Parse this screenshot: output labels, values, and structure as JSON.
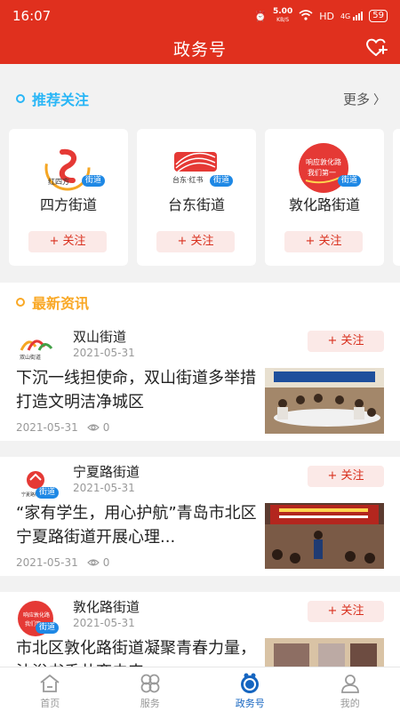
{
  "status": {
    "time": "16:07",
    "speed": "5.00",
    "speed_unit": "KB/S",
    "network": "HD",
    "signal": "4G",
    "battery": "59"
  },
  "header": {
    "title": "政务号"
  },
  "recommend": {
    "title": "推荐关注",
    "more": "更多",
    "items": [
      {
        "name": "四方街道",
        "tag": "街道",
        "follow": "+ 关注"
      },
      {
        "name": "台东街道",
        "tag": "街道",
        "follow": "+ 关注"
      },
      {
        "name": "敦化路街道",
        "tag": "街道",
        "follow": "+ 关注"
      }
    ]
  },
  "news": {
    "title": "最新资讯",
    "items": [
      {
        "source": "双山街道",
        "date": "2021-05-31",
        "follow": "+ 关注",
        "title": "下沉一线担使命，双山街道多举措打造文明洁净城区",
        "pub_date": "2021-05-31",
        "views": "0"
      },
      {
        "source": "宁夏路街道",
        "date": "2021-05-31",
        "follow": "+ 关注",
        "title": "“家有学生，用心护航”青岛市北区宁夏路街道开展心理...",
        "pub_date": "2021-05-31",
        "views": "0",
        "tag": "街道"
      },
      {
        "source": "敦化路街道",
        "date": "2021-05-31",
        "follow": "+ 关注",
        "title": "市北区敦化路街道凝聚青春力量，沐浴书香共育未来",
        "tag": "街道"
      }
    ]
  },
  "tabs": [
    {
      "label": "首页"
    },
    {
      "label": "服务"
    },
    {
      "label": "政务号"
    },
    {
      "label": "我的"
    }
  ],
  "colors": {
    "brand": "#e0301e",
    "accent": "#1565c0",
    "section_dot_1": "#29b6f6",
    "section_dot_2": "#f9a825"
  }
}
